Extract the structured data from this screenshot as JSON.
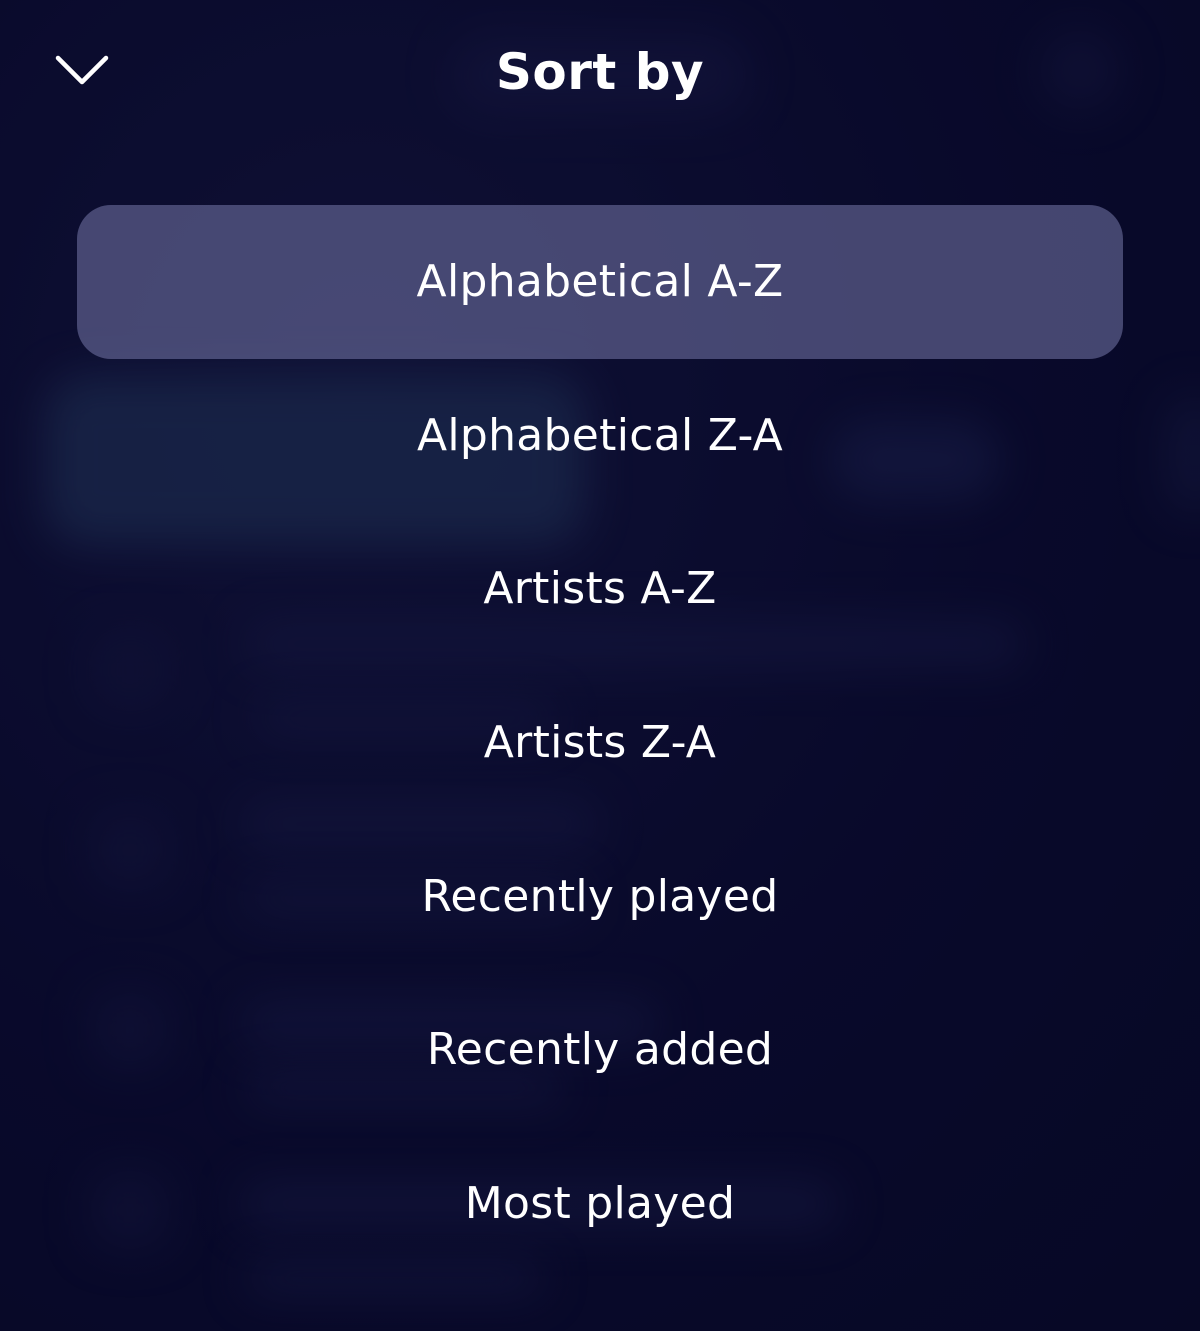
{
  "header": {
    "title": "Sort by",
    "close_icon": "chevron-down-icon"
  },
  "options": [
    {
      "label": "Alphabetical A-Z",
      "selected": true
    },
    {
      "label": "Alphabetical Z-A",
      "selected": false
    },
    {
      "label": "Artists A-Z",
      "selected": false
    },
    {
      "label": "Artists Z-A",
      "selected": false
    },
    {
      "label": "Recently played",
      "selected": false
    },
    {
      "label": "Recently added",
      "selected": false
    },
    {
      "label": "Most played",
      "selected": false
    }
  ],
  "colors": {
    "background": "#0b0c2e",
    "selected_highlight": "#3d3f63",
    "text": "#ffffff"
  }
}
